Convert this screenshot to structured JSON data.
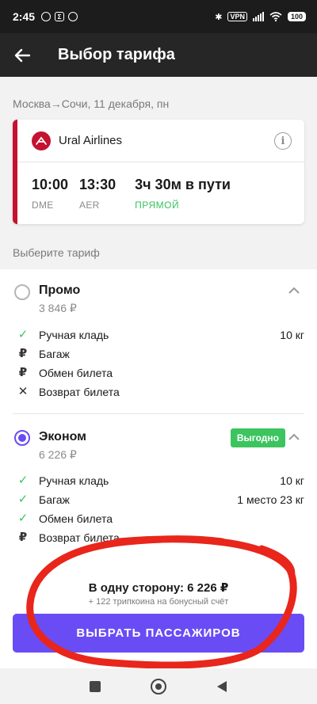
{
  "status_bar": {
    "time": "2:45",
    "vpn": "VPN",
    "battery": "100"
  },
  "app_bar": {
    "title": "Выбор тарифа"
  },
  "route": "Москва→Сочи, 11 декабря, пн",
  "flight": {
    "airline": "Ural Airlines",
    "departure_time": "10:00",
    "departure_code": "DME",
    "arrival_time": "13:30",
    "arrival_code": "AER",
    "duration": "3ч 30м в пути",
    "direct": "ПРЯМОЙ",
    "colors": {
      "airline_accent": "#c41230",
      "direct": "#38c25e"
    }
  },
  "choose_label": "Выберите тариф",
  "tariffs": [
    {
      "name": "Промо",
      "price": "3 846 ₽",
      "selected": false,
      "features": [
        {
          "icon": "check-icon",
          "label": "Ручная кладь",
          "value": "10 кг"
        },
        {
          "icon": "ruble-icon",
          "label": "Багаж",
          "value": ""
        },
        {
          "icon": "ruble-icon",
          "label": "Обмен билета",
          "value": ""
        },
        {
          "icon": "cross-icon",
          "label": "Возврат билета",
          "value": ""
        }
      ]
    },
    {
      "name": "Эконом",
      "price": "6 226 ₽",
      "badge": "Выгодно",
      "selected": true,
      "features": [
        {
          "icon": "check-icon",
          "label": "Ручная кладь",
          "value": "10 кг"
        },
        {
          "icon": "check-icon",
          "label": "Багаж",
          "value": "1 место 23 кг"
        },
        {
          "icon": "check-icon",
          "label": "Обмен билета",
          "value": ""
        },
        {
          "icon": "ruble-icon",
          "label": "Возврат билета",
          "value": ""
        }
      ]
    }
  ],
  "summary": {
    "one_way": "В одну сторону: 6 226 ₽",
    "bonus": "+ 122 трипкоина на бонусный счёт",
    "cta": "ВЫБРАТЬ ПАССАЖИРОВ"
  },
  "colors": {
    "primary": "#6a4cf5",
    "badge": "#3cc45f",
    "annotation": "#e8261c"
  }
}
